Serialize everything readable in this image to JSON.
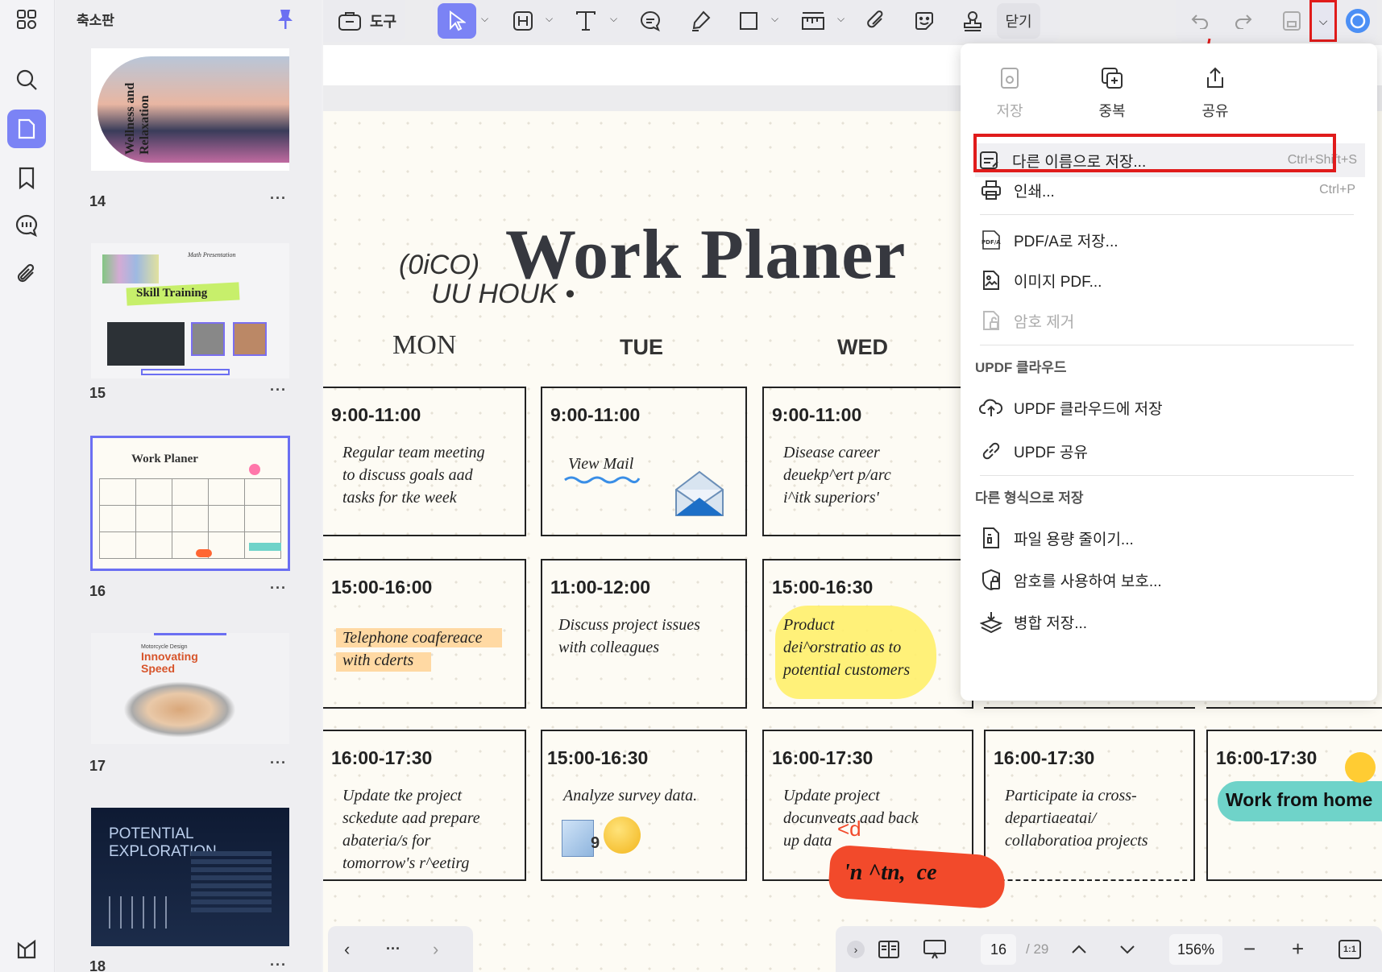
{
  "sidebar": {
    "title": "축소판",
    "pages": [
      "14",
      "15",
      "16",
      "17",
      "18"
    ],
    "more": "···"
  },
  "thumbs": {
    "p14": {
      "title": "Wellness and Relaxation"
    },
    "p15": {
      "title": "Skill Training",
      "subtitle": "Math Presentation"
    },
    "p16": {
      "title": "Work Planer"
    },
    "p17": {
      "title": "Innovating Speed",
      "subtitle": "Motorcycle Design"
    },
    "p18": {
      "title": "POTENTIAL EXPLORATION"
    }
  },
  "toolbar": {
    "tools_label": "도구",
    "close_label": "닫기"
  },
  "document": {
    "handwriting1": "(0iCO)",
    "handwriting2": "UU HOUK •",
    "title": "Work Planer",
    "days": [
      "MON",
      "TUE",
      "WED"
    ],
    "cells": [
      {
        "time": "9:00-11:00",
        "text": [
          "Regular team meeting",
          "to discuss goals aad",
          "tasks for tke week"
        ]
      },
      {
        "time": "9:00-11:00",
        "text": [
          "View Mail"
        ]
      },
      {
        "time": "9:00-11:00",
        "text": [
          "Disease career",
          "deuekp^ert p/arc",
          "i^itk superiors'"
        ]
      },
      {
        "time": "15:00-16:00",
        "text": [
          "Telephone coafereace",
          "with cderts"
        ]
      },
      {
        "time": "11:00-12:00",
        "text": [
          "Discuss project issues",
          "with colleagues"
        ]
      },
      {
        "time": "15:00-16:30",
        "text": [
          "Product",
          "dei^orstratio as to",
          "potential customers"
        ]
      },
      {
        "time": "16:00-17:30",
        "text": [
          "Update tke project",
          "sckedute aad prepare",
          "abateria/s for",
          "tomorrow's r^eetirg"
        ]
      },
      {
        "time": "15:00-16:30",
        "text": [
          "Analyze survey data."
        ]
      },
      {
        "time": "16:00-17:30",
        "text": [
          "Update project",
          "docunveats aad back",
          "up data"
        ]
      },
      {
        "time": "16:00-17:30",
        "text": [
          "Participate ia cross-",
          "departiaeatai/",
          "collaboratioa projects"
        ]
      },
      {
        "time": "16:00-17:30",
        "text": []
      }
    ],
    "work_from_home": "Work from home",
    "scribble": "'n ^tn,  ce",
    "scribble_small": "<d",
    "num9": "9"
  },
  "menu": {
    "top": [
      "저장",
      "중복",
      "공유"
    ],
    "save_as": {
      "label": "다른 이름으로 저장...",
      "shortcut": "Ctrl+Shift+S"
    },
    "print": {
      "label": "인쇄...",
      "shortcut": "Ctrl+P"
    },
    "pdfa": "PDF/A로 저장...",
    "image_pdf": "이미지 PDF...",
    "remove_pw": "암호 제거",
    "cloud_header": "UPDF 클라우드",
    "cloud_save": "UPDF 클라우드에 저장",
    "cloud_share": "UPDF 공유",
    "other_header": "다른 형식으로 저장",
    "reduce": "파일 용량 줄이기...",
    "protect": "암호를 사용하여 보호...",
    "merge": "병합 저장..."
  },
  "bottom": {
    "more": "···",
    "page": "16",
    "total": "/ 29",
    "zoom": "156%",
    "fit": "1:1"
  },
  "colors": {
    "accent": "#6b73f5",
    "highlight_red": "#e01b1b",
    "yellow_hl": "#fff06b",
    "orange_hl": "#ffd9a3",
    "teal": "#6fd3c9"
  }
}
